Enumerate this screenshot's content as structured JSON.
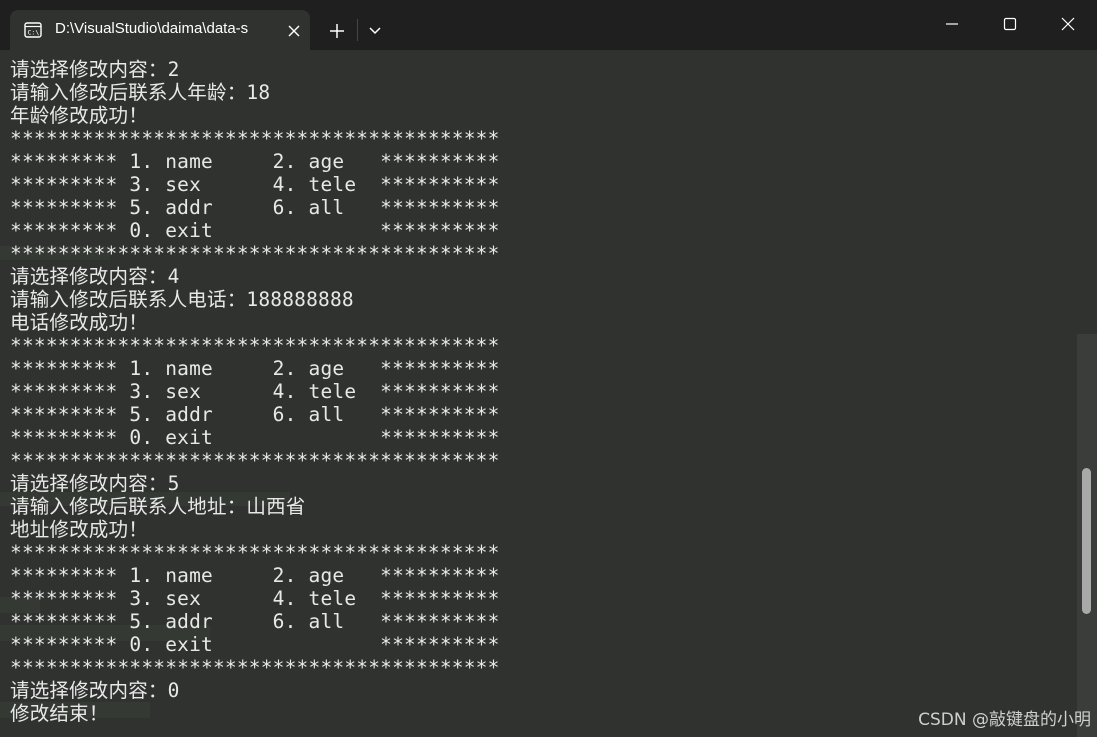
{
  "tab": {
    "title": "D:\\VisualStudio\\daima\\data-s",
    "icon": "terminal-icon"
  },
  "toolbar": {
    "new_tab_icon": "plus-icon",
    "dropdown_icon": "chevron-down-icon"
  },
  "window_controls": [
    "minimize-icon",
    "maximize-icon",
    "close-icon"
  ],
  "colors": {
    "terminal_bg": "#2f322f",
    "titlebar_bg": "#1f1f1f",
    "text": "#e8e8e8"
  },
  "terminal": {
    "lines": [
      "请选择修改内容：2",
      "请输入修改后联系人年龄：18",
      "年龄修改成功！",
      "*****************************************",
      "********* 1. name     2. age   **********",
      "********* 3. sex      4. tele  **********",
      "********* 5. addr     6. all   **********",
      "********* 0. exit              **********",
      "*****************************************",
      "请选择修改内容：4",
      "请输入修改后联系人电话：188888888",
      "电话修改成功！",
      "*****************************************",
      "********* 1. name     2. age   **********",
      "********* 3. sex      4. tele  **********",
      "********* 5. addr     6. all   **********",
      "********* 0. exit              **********",
      "*****************************************",
      "请选择修改内容：5",
      "请输入修改后联系人地址：山西省",
      "地址修改成功！",
      "*****************************************",
      "********* 1. name     2. age   **********",
      "********* 3. sex      4. tele  **********",
      "********* 5. addr     6. all   **********",
      "********* 0. exit              **********",
      "*****************************************",
      "请选择修改内容：0",
      "修改结束！"
    ]
  },
  "watermark": "CSDN @敲键盘的小明"
}
